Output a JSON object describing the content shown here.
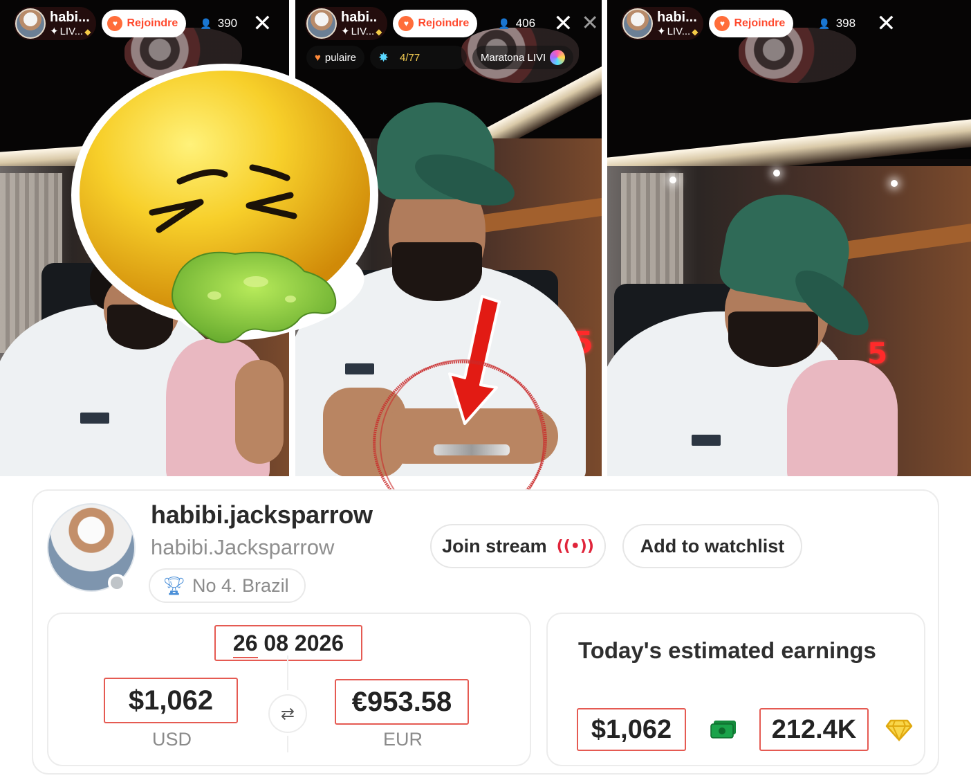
{
  "panels": [
    {
      "host_name": "habi...",
      "host_sub": "LIV...",
      "join_label": "Rejoindre",
      "viewers": "390",
      "close_glyph": "✕"
    },
    {
      "host_name": "habi..",
      "host_sub": "LIV...",
      "join_label": "Rejoindre",
      "viewers": "406",
      "close_glyph": "✕",
      "chips": {
        "gift_label": "pulaire",
        "progress": "4/77",
        "event_label": "Maratona LIVI"
      }
    },
    {
      "host_name": "habi...",
      "host_sub": "LIV...",
      "join_label": "Rejoindre",
      "viewers": "398",
      "close_glyph": "✕"
    }
  ],
  "icons": {
    "sticker": "nauseated-face-icon",
    "annotation": "red-arrow-icon",
    "join_live": "live-broadcast-icon",
    "rank": "trophy-icon",
    "swap": "swap-icon",
    "cash": "cash-icon",
    "gem": "diamond-icon"
  },
  "colors": {
    "accent_red": "#e55a52",
    "join_orange": "#ff4a2e",
    "cap_green": "#2f6a57",
    "diamond_gold": "#f5c431",
    "cash_green": "#1aa34a"
  },
  "profile": {
    "username": "habibi.jacksparrow",
    "display_name": "habibi.Jacksparrow",
    "rank": "No 4. Brazil",
    "join_stream_label": "Join stream",
    "watchlist_label": "Add to watchlist"
  },
  "conversion": {
    "date_day": "26",
    "date_rest": "08 2026",
    "usd_value": "$1,062",
    "usd_label": "USD",
    "eur_value": "€953.58",
    "eur_label": "EUR"
  },
  "earnings": {
    "title": "Today's estimated earnings",
    "usd_value": "$1,062",
    "gem_value": "212.4K"
  }
}
